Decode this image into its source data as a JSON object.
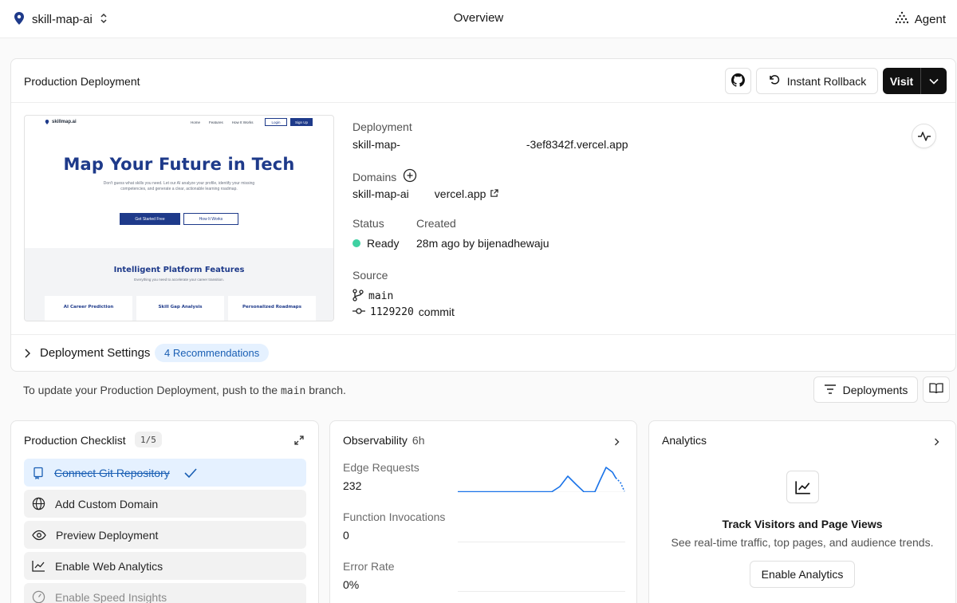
{
  "topbar": {
    "project_name": "skill-map-ai",
    "title": "Overview",
    "agent_label": "Agent"
  },
  "production": {
    "title": "Production Deployment",
    "rollback_label": "Instant Rollback",
    "visit_label": "Visit",
    "deployment_label": "Deployment",
    "deployment_url_start": "skill-map-",
    "deployment_url_end": "-3ef8342f.vercel.app",
    "domains_label": "Domains",
    "domain_start": "skill-map-ai",
    "domain_end": "vercel.app",
    "status_label": "Status",
    "status_value": "Ready",
    "created_label": "Created",
    "created_value": "28m ago by bijenadhewaju",
    "source_label": "Source",
    "branch": "main",
    "commit_hash": "1129220",
    "commit_label": "commit",
    "settings_label": "Deployment Settings",
    "recommendations": "4 Recommendations",
    "status_color": "#3fd1a2"
  },
  "preview": {
    "logo_text": "skillmap.ai",
    "nav_links": [
      "Home",
      "Features",
      "How It Works"
    ],
    "login": "Login",
    "signup": "Sign Up",
    "hero_title": "Map Your Future in Tech",
    "hero_sub": "Don't guess what skills you need. Let our AI analyze your profile, identify your missing competencies, and generate a clear, actionable learning roadmap.",
    "cta_primary": "Get Started Free",
    "cta_secondary": "How It Works",
    "features_title": "Intelligent Platform Features",
    "features_sub": "Everything you need to accelerate your career transition.",
    "cards": [
      "AI Career Prediction",
      "Skill Gap Analysis",
      "Personalized Roadmaps"
    ]
  },
  "info": {
    "text_before": "To update your Production Deployment, push to the",
    "branch": "main",
    "text_after": "branch.",
    "deployments_label": "Deployments"
  },
  "checklist": {
    "title": "Production Checklist",
    "progress": "1/5",
    "items": [
      {
        "label": "Connect Git Repository",
        "icon": "repo-icon"
      },
      {
        "label": "Add Custom Domain",
        "icon": "globe-icon"
      },
      {
        "label": "Preview Deployment",
        "icon": "eye-icon"
      },
      {
        "label": "Enable Web Analytics",
        "icon": "chart-icon"
      },
      {
        "label": "Enable Speed Insights",
        "icon": "gauge-icon"
      }
    ]
  },
  "observability": {
    "title": "Observability",
    "window": "6h",
    "metrics": [
      {
        "label": "Edge Requests",
        "value": "232"
      },
      {
        "label": "Function Invocations",
        "value": "0"
      },
      {
        "label": "Error Rate",
        "value": "0%"
      }
    ],
    "accent": "#1a73e8"
  },
  "analytics": {
    "title": "Analytics",
    "heading": "Track Visitors and Page Views",
    "sub": "See real-time traffic, top pages, and audience trends.",
    "button": "Enable Analytics"
  }
}
